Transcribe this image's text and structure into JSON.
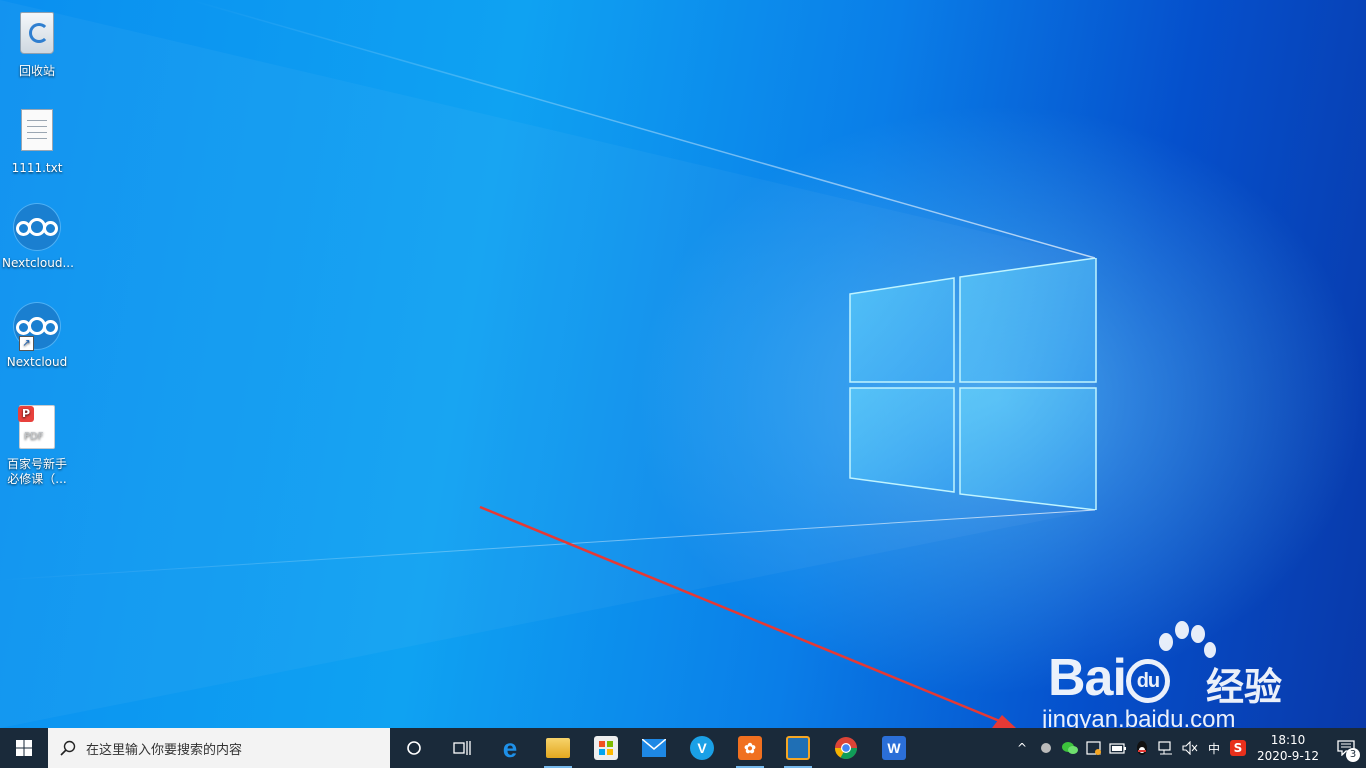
{
  "desktop": {
    "icons": [
      {
        "label": "回收站",
        "icon": "recycle-bin-icon"
      },
      {
        "label": "1111.txt",
        "icon": "text-file-icon"
      },
      {
        "label": "Nextcloud...",
        "icon": "nextcloud-icon"
      },
      {
        "label": "Nextcloud",
        "icon": "nextcloud-shortcut-icon"
      },
      {
        "label": "百家号新手必修课（...",
        "icon": "pdf-file-icon"
      }
    ]
  },
  "watermark": {
    "brand": "Bai",
    "brand_suffix": "du",
    "cn": "经验",
    "url": "jingyan.baidu.com"
  },
  "taskbar": {
    "search_placeholder": "在这里输入你要搜索的内容",
    "pinned": [
      {
        "name": "cortana",
        "icon": "cortana-circle-icon"
      },
      {
        "name": "task-view",
        "icon": "task-view-icon"
      },
      {
        "name": "edge",
        "icon": "edge-icon"
      },
      {
        "name": "file-explorer",
        "icon": "folder-icon"
      },
      {
        "name": "store",
        "icon": "store-bag-icon"
      },
      {
        "name": "mail",
        "icon": "mail-icon"
      },
      {
        "name": "app-v",
        "icon": "v-app-icon"
      },
      {
        "name": "app-orange",
        "icon": "orange-gear-icon"
      },
      {
        "name": "app-window",
        "icon": "window-app-icon"
      },
      {
        "name": "chrome",
        "icon": "chrome-icon"
      },
      {
        "name": "wps",
        "icon": "wps-icon"
      }
    ],
    "tray": {
      "chevron": "^",
      "ime": "中",
      "icons": [
        "nextcloud-tray-icon",
        "wechat-icon",
        "tray-app-icon",
        "battery-icon",
        "qq-icon",
        "network-icon",
        "volume-muted-icon",
        "sogou-icon"
      ]
    },
    "clock": {
      "time": "18:10",
      "date": "2020-9-12"
    },
    "notifications": "3"
  },
  "colors": {
    "taskbar": "#1a2a3a",
    "accent": "#76b9ed",
    "arrow": "#e53935"
  }
}
